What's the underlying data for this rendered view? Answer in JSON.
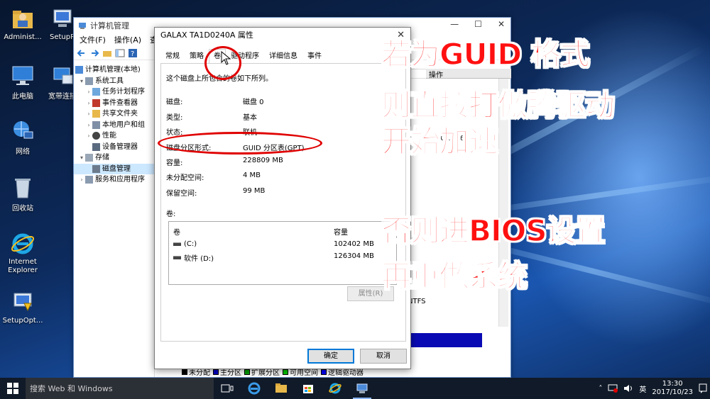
{
  "desktop": {
    "icons": [
      {
        "label": "Administ...",
        "icon": "user-folder-icon"
      },
      {
        "label": "SetupR",
        "icon": "setup-icon"
      },
      {
        "label": "此电脑",
        "icon": "computer-icon"
      },
      {
        "label": "宽带连接",
        "icon": "broadband-icon"
      },
      {
        "label": "网络",
        "icon": "network-icon"
      },
      {
        "label": "回收站",
        "icon": "recycle-bin-icon"
      },
      {
        "label": "Internet Explorer",
        "icon": "ie-icon"
      },
      {
        "label": "SetupOpt...",
        "icon": "setup-opt-icon"
      }
    ]
  },
  "computer_management": {
    "title": "计算机管理",
    "menu": [
      "文件(F)",
      "操作(A)",
      "查看"
    ],
    "tree": [
      {
        "label": "计算机管理(本地)",
        "level": 0
      },
      {
        "label": "系统工具",
        "level": 1
      },
      {
        "label": "任务计划程序",
        "level": 2
      },
      {
        "label": "事件查看器",
        "level": 2
      },
      {
        "label": "共享文件夹",
        "level": 2
      },
      {
        "label": "本地用户和组",
        "level": 2
      },
      {
        "label": "性能",
        "level": 2
      },
      {
        "label": "设备管理器",
        "level": 2
      },
      {
        "label": "存储",
        "level": 1
      },
      {
        "label": "磁盘管理",
        "level": 2,
        "selected": true
      },
      {
        "label": "服务和应用程序",
        "level": 1
      }
    ],
    "right_pane": {
      "header": "操作",
      "column": "可用",
      "usage_row": "GB   412.60 GB   67 %",
      "fs_label": "NTFS"
    },
    "legend": [
      "未分配",
      "主分区",
      "扩展分区",
      "可用空间",
      "逻辑驱动器"
    ],
    "legend_colors": [
      "#000000",
      "#0000c8",
      "#00a000",
      "#00c800",
      "#0000ff"
    ]
  },
  "dialog": {
    "title": "GALAX TA1D0240A 属性",
    "tabs": [
      "常规",
      "策略",
      "卷",
      "驱动程序",
      "详细信息",
      "事件"
    ],
    "active_tab": "卷",
    "description": "这个磁盘上所包含的卷如下所列。",
    "properties": [
      {
        "label": "磁盘:",
        "value": "磁盘 0"
      },
      {
        "label": "类型:",
        "value": "基本"
      },
      {
        "label": "状态:",
        "value": "联机"
      },
      {
        "label": "磁盘分区形式:",
        "value": "GUID 分区表(GPT)"
      },
      {
        "label": "容量:",
        "value": "228809 MB"
      },
      {
        "label": "未分配空间:",
        "value": "4 MB"
      },
      {
        "label": "保留空间:",
        "value": "99 MB"
      }
    ],
    "volumes_caption": "卷:",
    "volume_headers": {
      "name": "卷",
      "capacity": "容量"
    },
    "volumes": [
      {
        "name": "(C:)",
        "capacity": "102402 MB"
      },
      {
        "name": "软件 (D:)",
        "capacity": "126304 MB"
      }
    ],
    "properties_button": "属性(R)",
    "ok_button": "确定",
    "cancel_button": "取消"
  },
  "overlay_text": {
    "line1": "若为GUID 格式",
    "line2": "则直接打傲腾驱动",
    "line3": "开始加速",
    "line4": "否则进BIOS设置",
    "line5": "再重做系统",
    "color": "#ff1010"
  },
  "taskbar": {
    "search_placeholder": "搜索 Web 和 Windows",
    "apps": [
      "task-view-icon",
      "edge-icon",
      "file-explorer-icon",
      "store-icon",
      "ie-icon",
      "computer-management-icon"
    ],
    "ime": "英",
    "time": "13:30",
    "date": "2017/10/23"
  }
}
